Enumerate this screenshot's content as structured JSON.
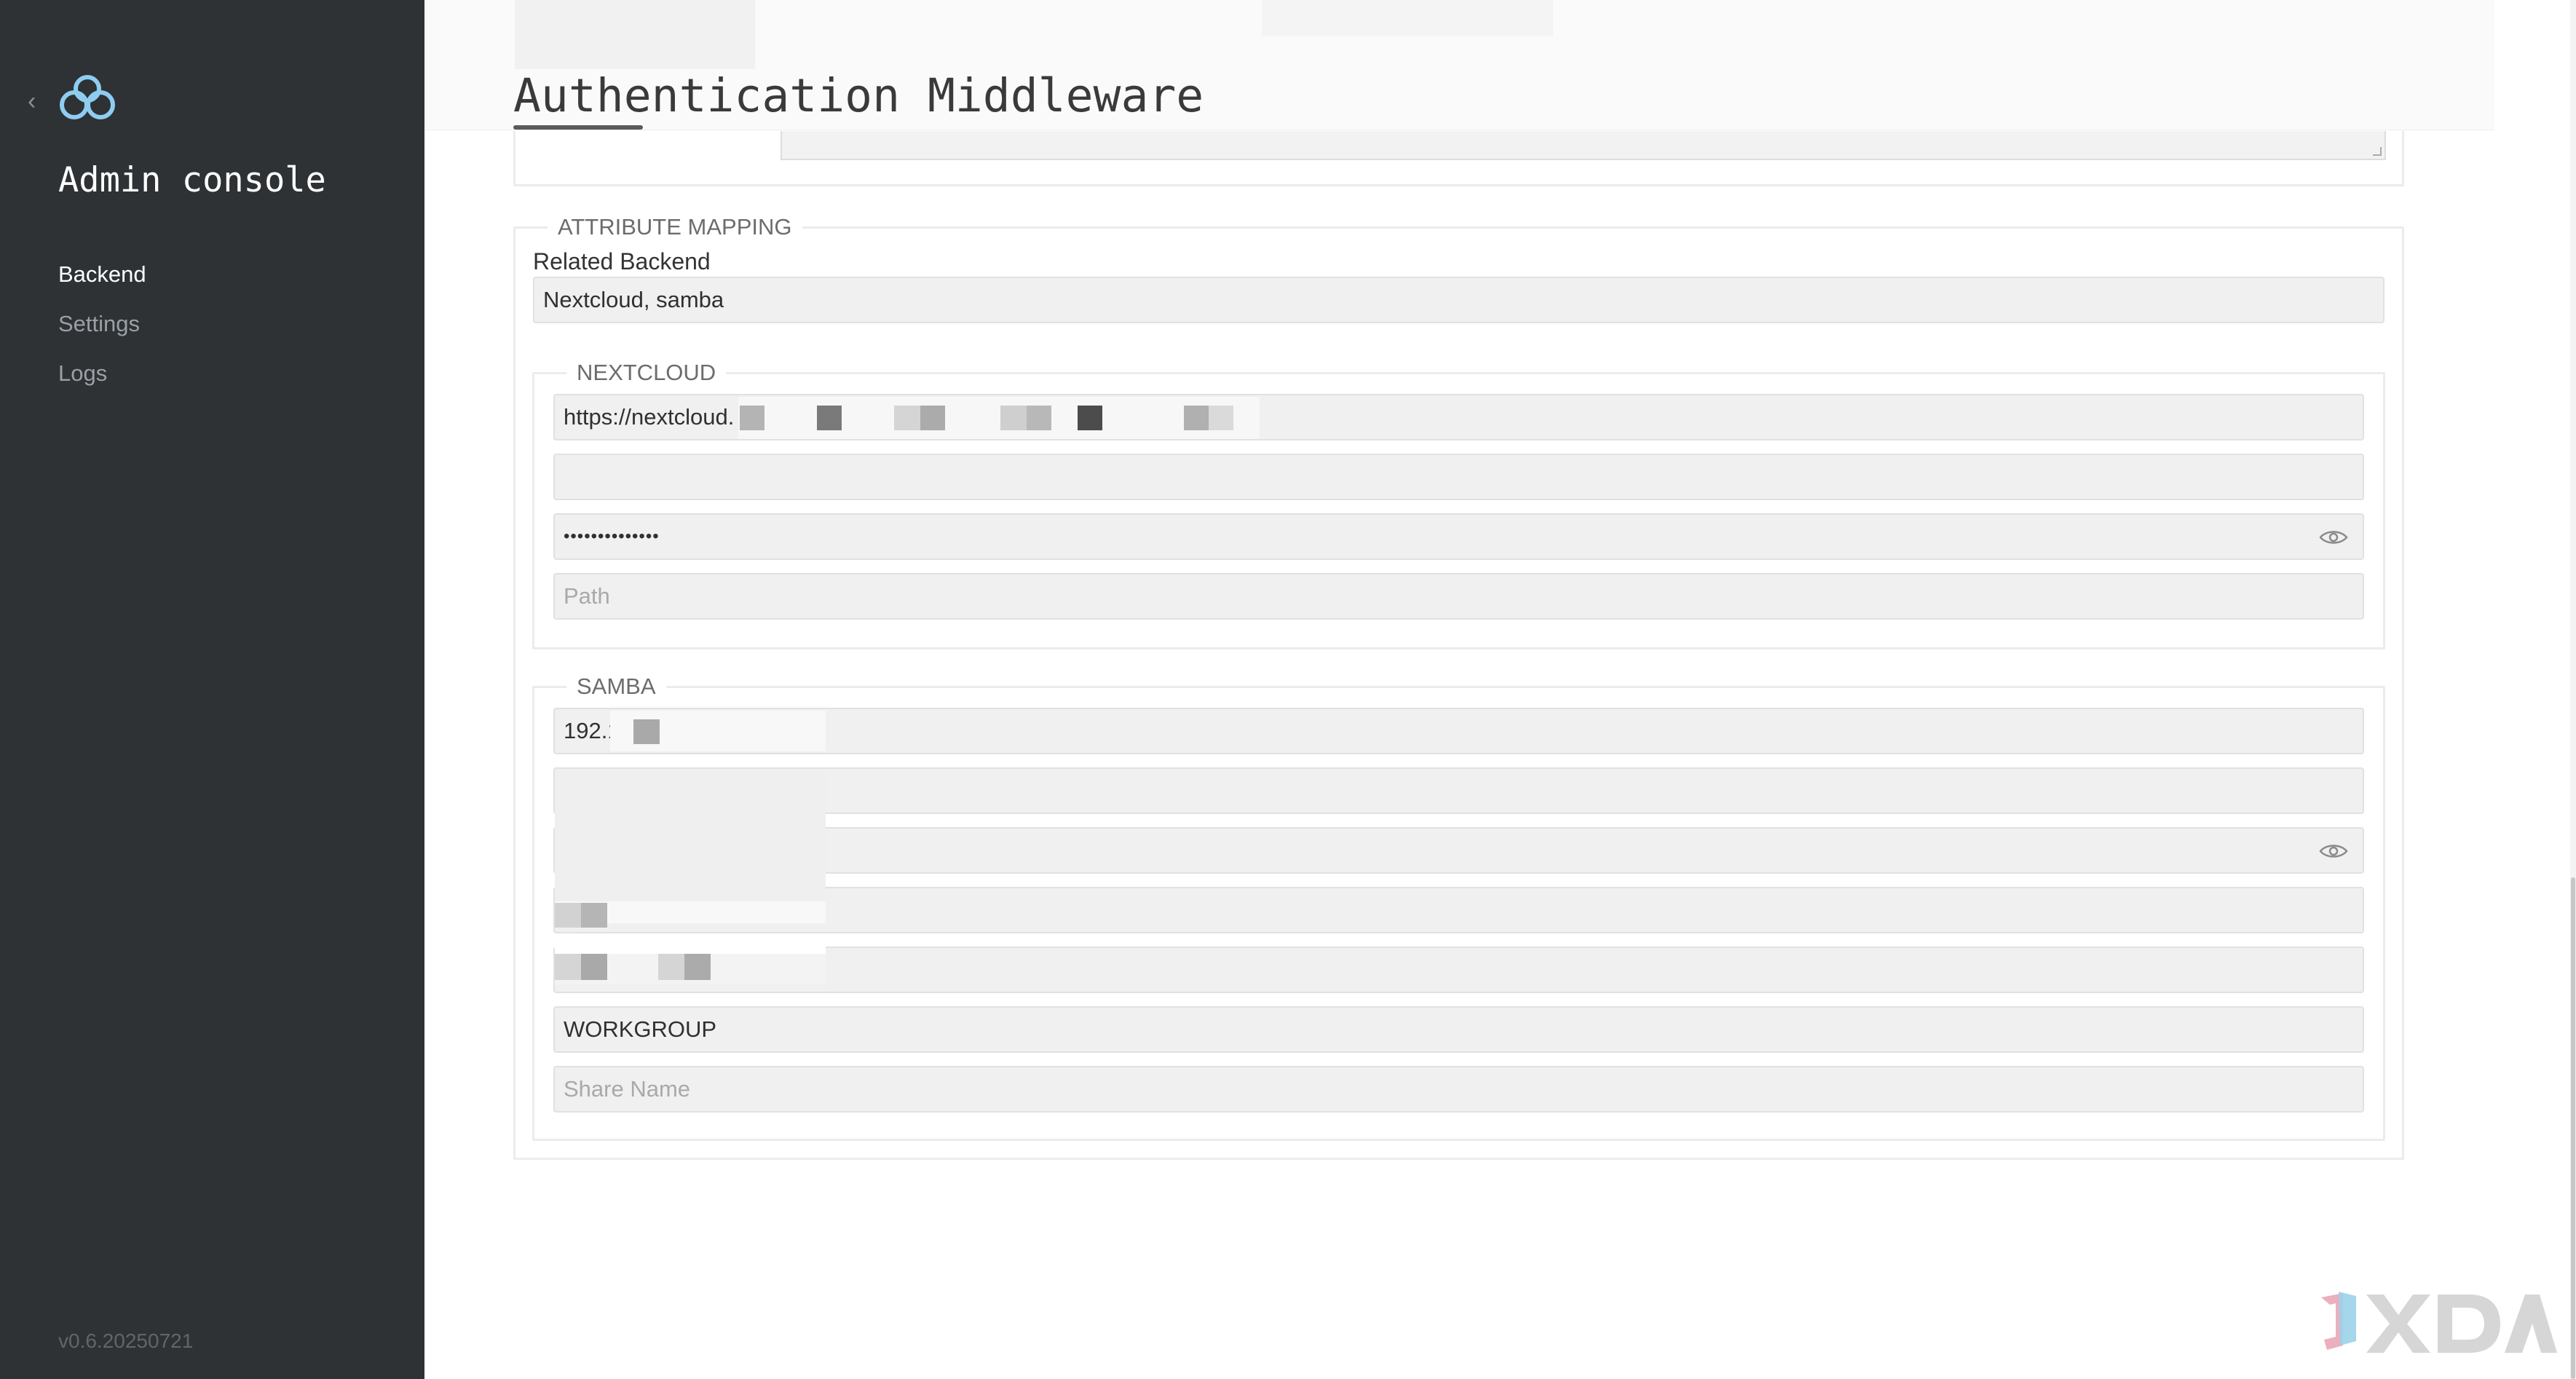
{
  "sidebar": {
    "title": "Admin console",
    "nav": [
      {
        "label": "Backend",
        "active": true
      },
      {
        "label": "Settings",
        "active": false
      },
      {
        "label": "Logs",
        "active": false
      }
    ],
    "version": "v0.6.20250721",
    "icons": {
      "back": "chevron-left-icon",
      "logo": "cloud-logo-icon"
    }
  },
  "header": {
    "title": "Authentication Middleware"
  },
  "attribute_mapping": {
    "legend": "ATTRIBUTE MAPPING",
    "related_backend_label": "Related Backend",
    "related_backend_value": "Nextcloud, samba"
  },
  "nextcloud": {
    "legend": "NEXTCLOUD",
    "url_value": "https://nextcloud.",
    "password_mask": "••••••••••••••",
    "path_placeholder": "Path"
  },
  "samba": {
    "legend": "SAMBA",
    "host_value": "192.1",
    "workgroup_value": "WORKGROUP",
    "share_placeholder": "Share Name"
  },
  "colors": {
    "sidebar_bg": "#2e3235",
    "logo": "#8ecdf0",
    "field_bg": "#f0f0f0"
  }
}
